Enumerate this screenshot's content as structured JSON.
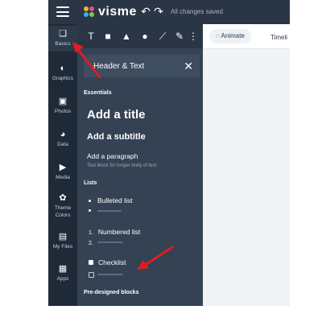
{
  "app": {
    "brand": "visme",
    "status": "All changes saved",
    "accent": "#e11b22"
  },
  "rail": {
    "items": [
      {
        "label": "Basics",
        "icon": "shapes-icon"
      },
      {
        "label": "Graphics",
        "icon": "graphics-icon"
      },
      {
        "label": "Photos",
        "icon": "photo-icon"
      },
      {
        "label": "Data",
        "icon": "chart-icon"
      },
      {
        "label": "Media",
        "icon": "media-icon"
      },
      {
        "label": "Theme\nColors",
        "icon": "palette-icon"
      },
      {
        "label": "My Files",
        "icon": "folder-icon"
      },
      {
        "label": "Apps",
        "icon": "apps-icon"
      }
    ]
  },
  "tools": [
    "T",
    "■",
    "▲",
    "●",
    "⟋",
    "✎",
    "⋮"
  ],
  "panel": {
    "title": "Header & Text",
    "essentials_label": "Essentials",
    "add_title": "Add a title",
    "add_subtitle": "Add a subtitle",
    "add_paragraph": "Add a paragraph",
    "paragraph_hint": "Text block for longer body of text",
    "lists_label": "Lists",
    "bulleted": "Bulleted list",
    "numbered": "Numbered list",
    "numbered_1": "1.",
    "numbered_2": "2.",
    "checklist": "Checklist",
    "predesigned_label": "Pre-designed blocks"
  },
  "canvas": {
    "animate": "Animate",
    "timeline": "Timeli"
  }
}
